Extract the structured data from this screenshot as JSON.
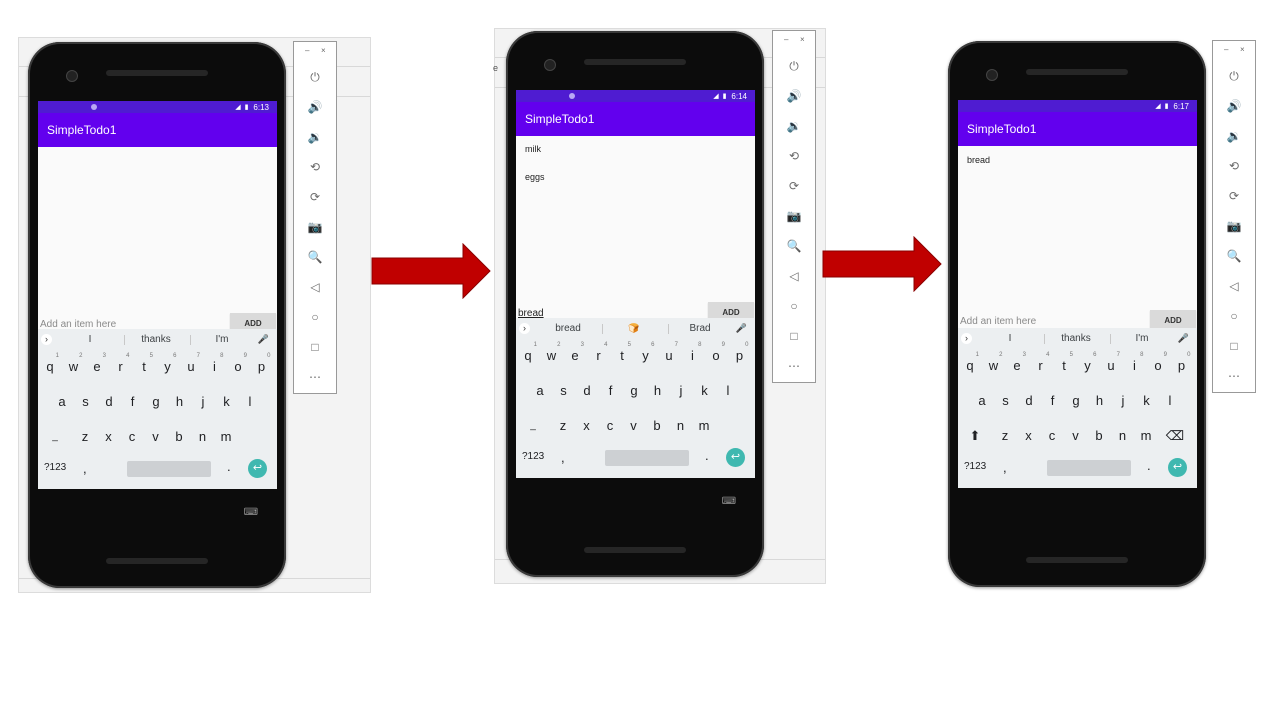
{
  "screens": [
    {
      "time": "6:13",
      "app_title": "SimpleTodo1",
      "items": [],
      "input_value": "",
      "input_placeholder": "Add an item here",
      "add_label": "ADD",
      "suggestions": [
        "I",
        "thanks",
        "I'm"
      ],
      "show_shift": false
    },
    {
      "time": "6:14",
      "app_title": "SimpleTodo1",
      "items": [
        "milk",
        "eggs"
      ],
      "input_value": "bread",
      "input_placeholder": "",
      "add_label": "ADD",
      "suggestions": [
        "bread",
        "🍞",
        "Brad"
      ],
      "show_shift": false
    },
    {
      "time": "6:17",
      "app_title": "SimpleTodo1",
      "items": [
        "bread"
      ],
      "input_value": "",
      "input_placeholder": "Add an item here",
      "add_label": "ADD",
      "suggestions": [
        "I",
        "thanks",
        "I'm"
      ],
      "show_shift": true
    }
  ],
  "keyboard": {
    "row1": [
      "q",
      "w",
      "e",
      "r",
      "t",
      "y",
      "u",
      "i",
      "o",
      "p"
    ],
    "row1_hints": [
      "1",
      "2",
      "3",
      "4",
      "5",
      "6",
      "7",
      "8",
      "9",
      "0"
    ],
    "row2": [
      "a",
      "s",
      "d",
      "f",
      "g",
      "h",
      "j",
      "k",
      "l"
    ],
    "row3": [
      "z",
      "x",
      "c",
      "v",
      "b",
      "n",
      "m"
    ],
    "symbols_label": "?123",
    "comma": ",",
    "period": ".",
    "underscore": "_"
  },
  "emulator_toolbar": {
    "minimize": "–",
    "close": "×",
    "icons": [
      "power-icon",
      "volume-up-icon",
      "volume-down-icon",
      "rotate-left-icon",
      "rotate-right-icon",
      "camera-icon",
      "zoom-icon",
      "back-icon",
      "home-icon",
      "overview-icon",
      "more-icon"
    ]
  },
  "background_fragment": "e",
  "colors": {
    "status_bar": "#4f1cd1",
    "app_bar": "#6200ee",
    "accent": "#3fb8b0",
    "arrow": "#c00000"
  }
}
